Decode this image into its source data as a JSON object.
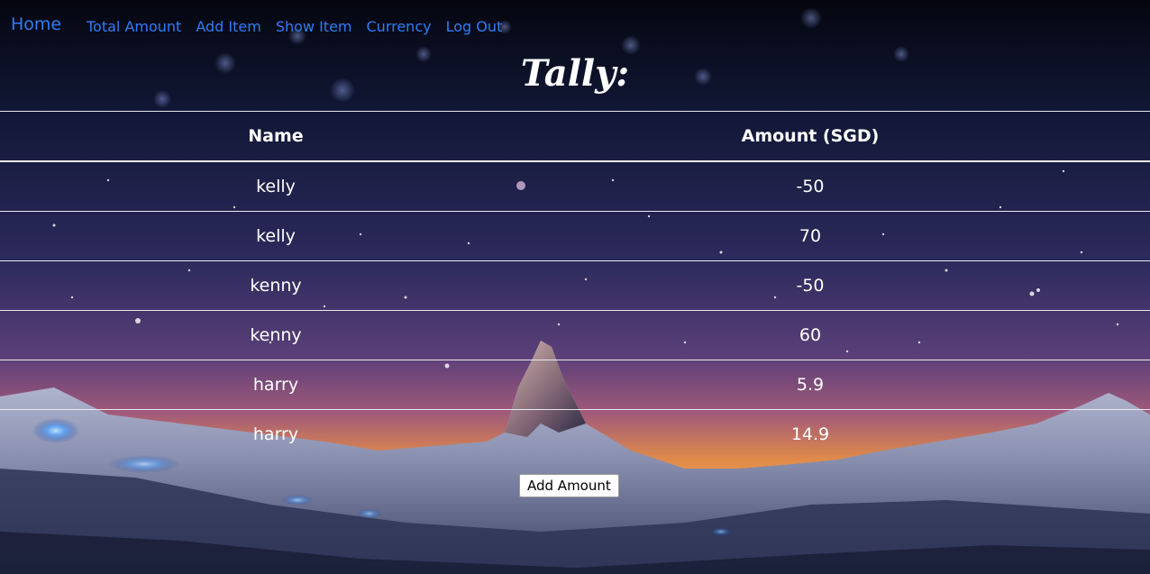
{
  "nav": {
    "brand": "Home",
    "links": [
      "Total Amount",
      "Add Item",
      "Show Item",
      "Currency",
      "Log Out"
    ],
    "link_color": "#2f7cf6"
  },
  "page": {
    "title": "Tally:"
  },
  "table": {
    "headers": [
      "Name",
      "Amount (SGD)"
    ],
    "rows": [
      {
        "name": "kelly",
        "amount": "-50"
      },
      {
        "name": "kelly",
        "amount": "70"
      },
      {
        "name": "kenny",
        "amount": "-50"
      },
      {
        "name": "kenny",
        "amount": "60"
      },
      {
        "name": "harry",
        "amount": "5.9"
      },
      {
        "name": "harry",
        "amount": "14.9"
      }
    ]
  },
  "actions": {
    "add_amount_label": "Add Amount"
  },
  "background": {
    "description_icon": "starry-mountain-background",
    "sky_top": "#0b0e22",
    "sky_mid": "#3a3470",
    "horizon_orange": "#e88a3c"
  }
}
